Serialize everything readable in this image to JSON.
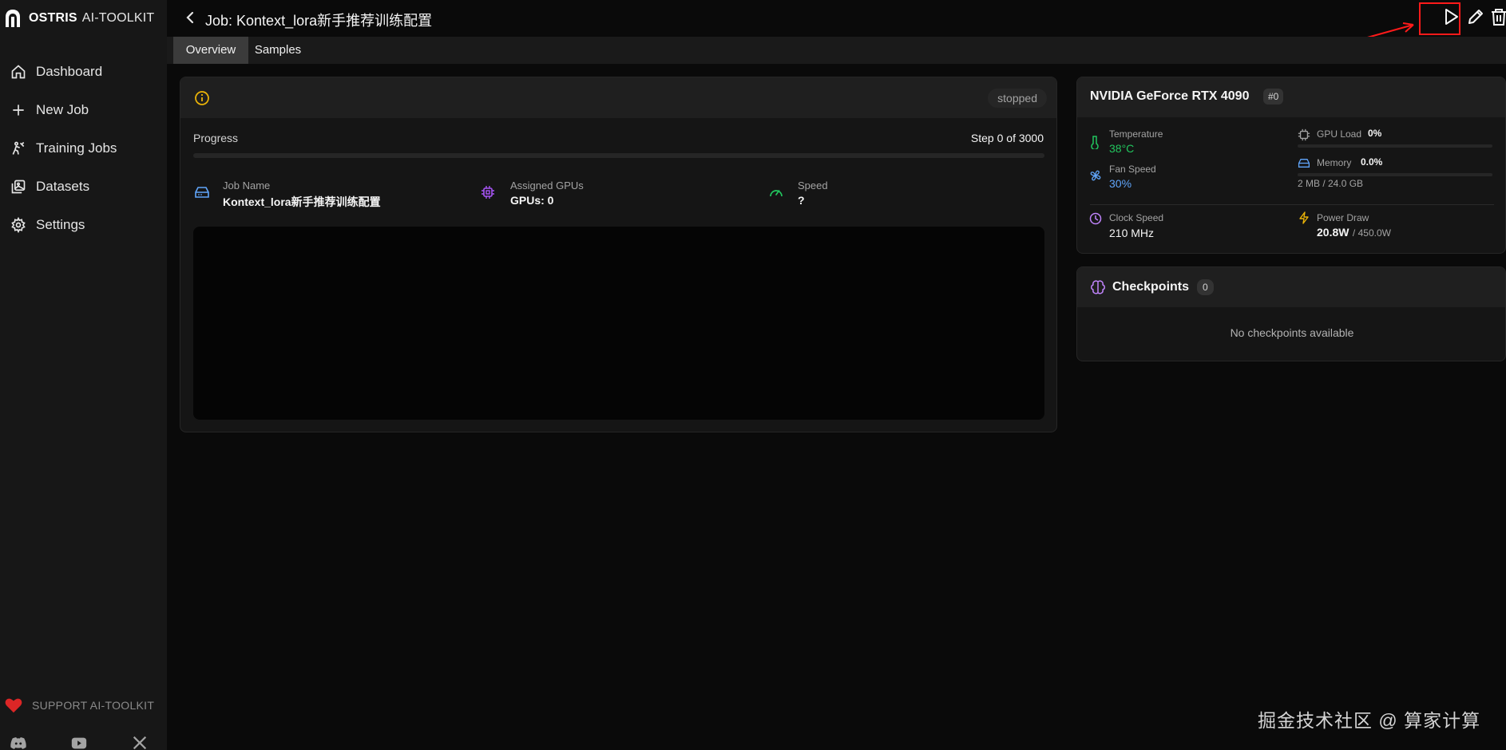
{
  "brand": {
    "name": "OSTRIS",
    "sub": "AI-TOOLKIT"
  },
  "sidebar": {
    "items": [
      {
        "label": "Dashboard",
        "icon": "home-icon"
      },
      {
        "label": "New Job",
        "icon": "plus-icon"
      },
      {
        "label": "Training Jobs",
        "icon": "training-icon"
      },
      {
        "label": "Datasets",
        "icon": "image-icon"
      },
      {
        "label": "Settings",
        "icon": "gear-icon"
      }
    ],
    "support": "SUPPORT AI-TOOLKIT",
    "socials": [
      "discord-icon",
      "youtube-icon",
      "x-icon"
    ]
  },
  "header": {
    "title": "Job: Kontext_lora新手推荐训练配置"
  },
  "tabs": [
    {
      "label": "Overview",
      "active": true
    },
    {
      "label": "Samples",
      "active": false
    }
  ],
  "job_card": {
    "status": "stopped",
    "progress_label": "Progress",
    "progress_text": "Step 0 of 3000",
    "progress_fraction": 0,
    "job_name_label": "Job Name",
    "job_name": "Kontext_lora新手推荐训练配置",
    "gpus_label": "Assigned GPUs",
    "gpus_value": "GPUs: 0",
    "speed_label": "Speed",
    "speed_value": "?"
  },
  "gpu_card": {
    "title": "NVIDIA GeForce RTX 4090",
    "index": "#0",
    "temperature_label": "Temperature",
    "temperature": "38°C",
    "fan_label": "Fan Speed",
    "fan": "30%",
    "gpu_load_label": "GPU Load",
    "gpu_load": "0%",
    "gpu_load_fraction": 0,
    "memory_label": "Memory",
    "memory": "0.0%",
    "memory_fraction": 0,
    "memory_detail": "2 MB / 24.0 GB",
    "clock_label": "Clock Speed",
    "clock": "210 MHz",
    "power_label": "Power Draw",
    "power": "20.8W",
    "power_max": "/ 450.0W"
  },
  "checkpoints_card": {
    "title": "Checkpoints",
    "count": "0",
    "empty_text": "No checkpoints available"
  },
  "watermark": "掘金技术社区 @ 算家计算",
  "colors": {
    "accent_blue": "#3b82f6",
    "green": "#22c55e",
    "yellow": "#eab308",
    "purple": "#a855f7",
    "red_highlight": "#ff1a1a"
  }
}
